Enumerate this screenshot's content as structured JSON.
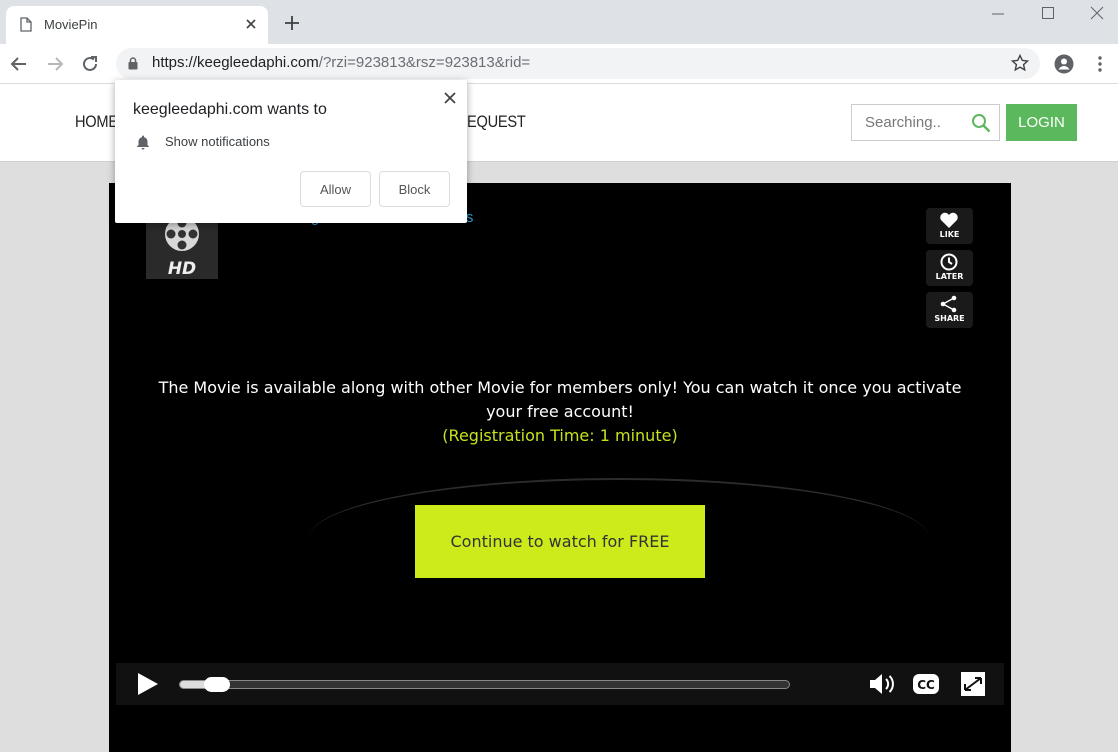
{
  "browser": {
    "tab_title": "MoviePin",
    "url_host": "https://keegleedaphi.com",
    "url_rest": "/?rzi=923813&rsz=923813&rid="
  },
  "site": {
    "nav": [
      "HOME",
      "EQUEST"
    ],
    "search_placeholder": "Searching..",
    "login_label": "LOGIN",
    "accent_green": "#5cb85c"
  },
  "player": {
    "link_text": "HD Streaming · Unlimited Downloads",
    "side_buttons": [
      "LIKE",
      "LATER",
      "SHARE"
    ],
    "message": "The Movie is available along with other Movie for members only! You can watch it once you activate your free account!",
    "registration_time": "(Registration Time: 1 minute)",
    "cta_label": "Continue to watch for FREE",
    "progress": 0.04,
    "cta_color": "#cdeb1a"
  },
  "popup": {
    "title": "keegleedaphi.com wants to",
    "permission": "Show notifications",
    "allow_label": "Allow",
    "block_label": "Block"
  }
}
